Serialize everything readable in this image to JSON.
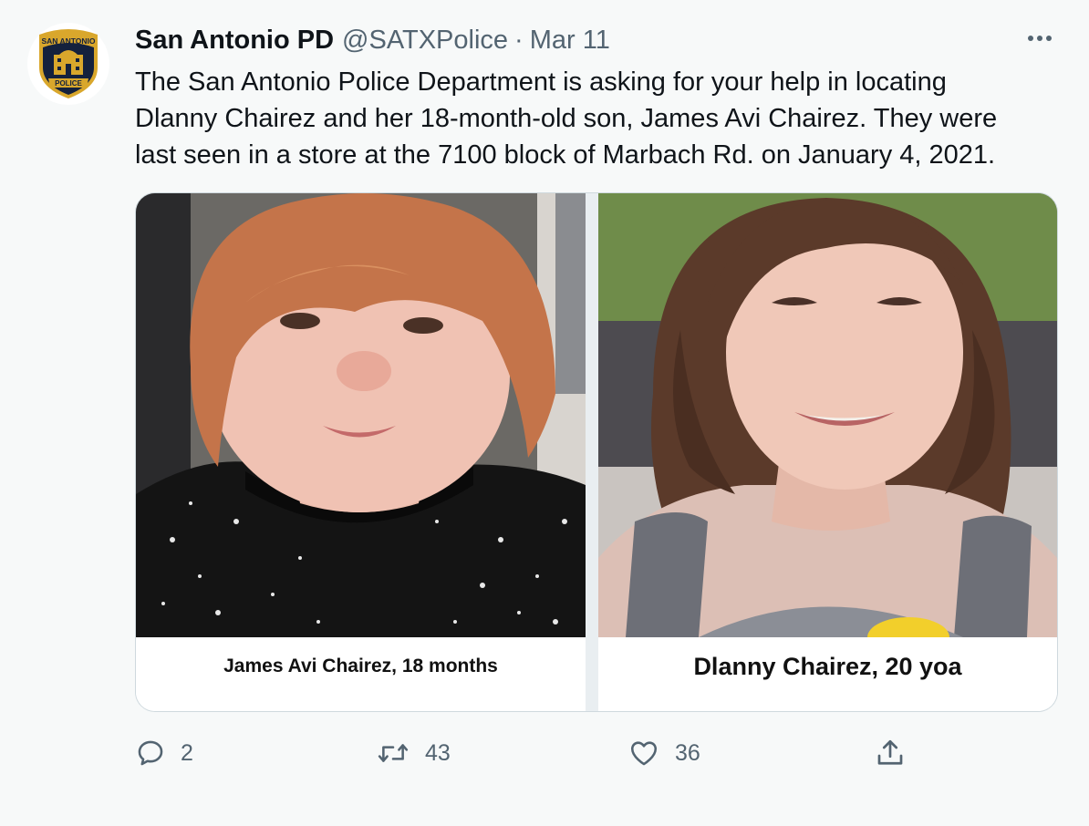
{
  "tweet": {
    "author": {
      "display_name": "San Antonio PD",
      "handle": "@SATXPolice",
      "separator": "·",
      "date": "Mar 11",
      "avatar_badge": {
        "top_text": "SAN ANTONIO",
        "bottom_text": "POLICE"
      }
    },
    "text": "The San Antonio Police Department is asking for your help in locating\nDlanny Chairez and her 18-month-old son, James Avi Chairez.  They were\nlast seen in a store at the 7100 block of Marbach Rd. on January 4, 2021.",
    "media": {
      "left": {
        "caption": "James Avi Chairez, 18 months"
      },
      "right": {
        "caption": "Dlanny Chairez, 20 yoa"
      }
    },
    "actions": {
      "reply": {
        "icon": "reply-icon",
        "count": "2"
      },
      "retweet": {
        "icon": "retweet-icon",
        "count": "43"
      },
      "like": {
        "icon": "heart-icon",
        "count": "36"
      },
      "share": {
        "icon": "share-icon"
      }
    },
    "more_icon": "more-icon"
  },
  "colors": {
    "background": "#f7f9f9",
    "text_primary": "#0f1419",
    "text_secondary": "#536471",
    "border": "#cfd9de",
    "badge_gold": "#d9a72c",
    "badge_navy": "#14213d"
  }
}
